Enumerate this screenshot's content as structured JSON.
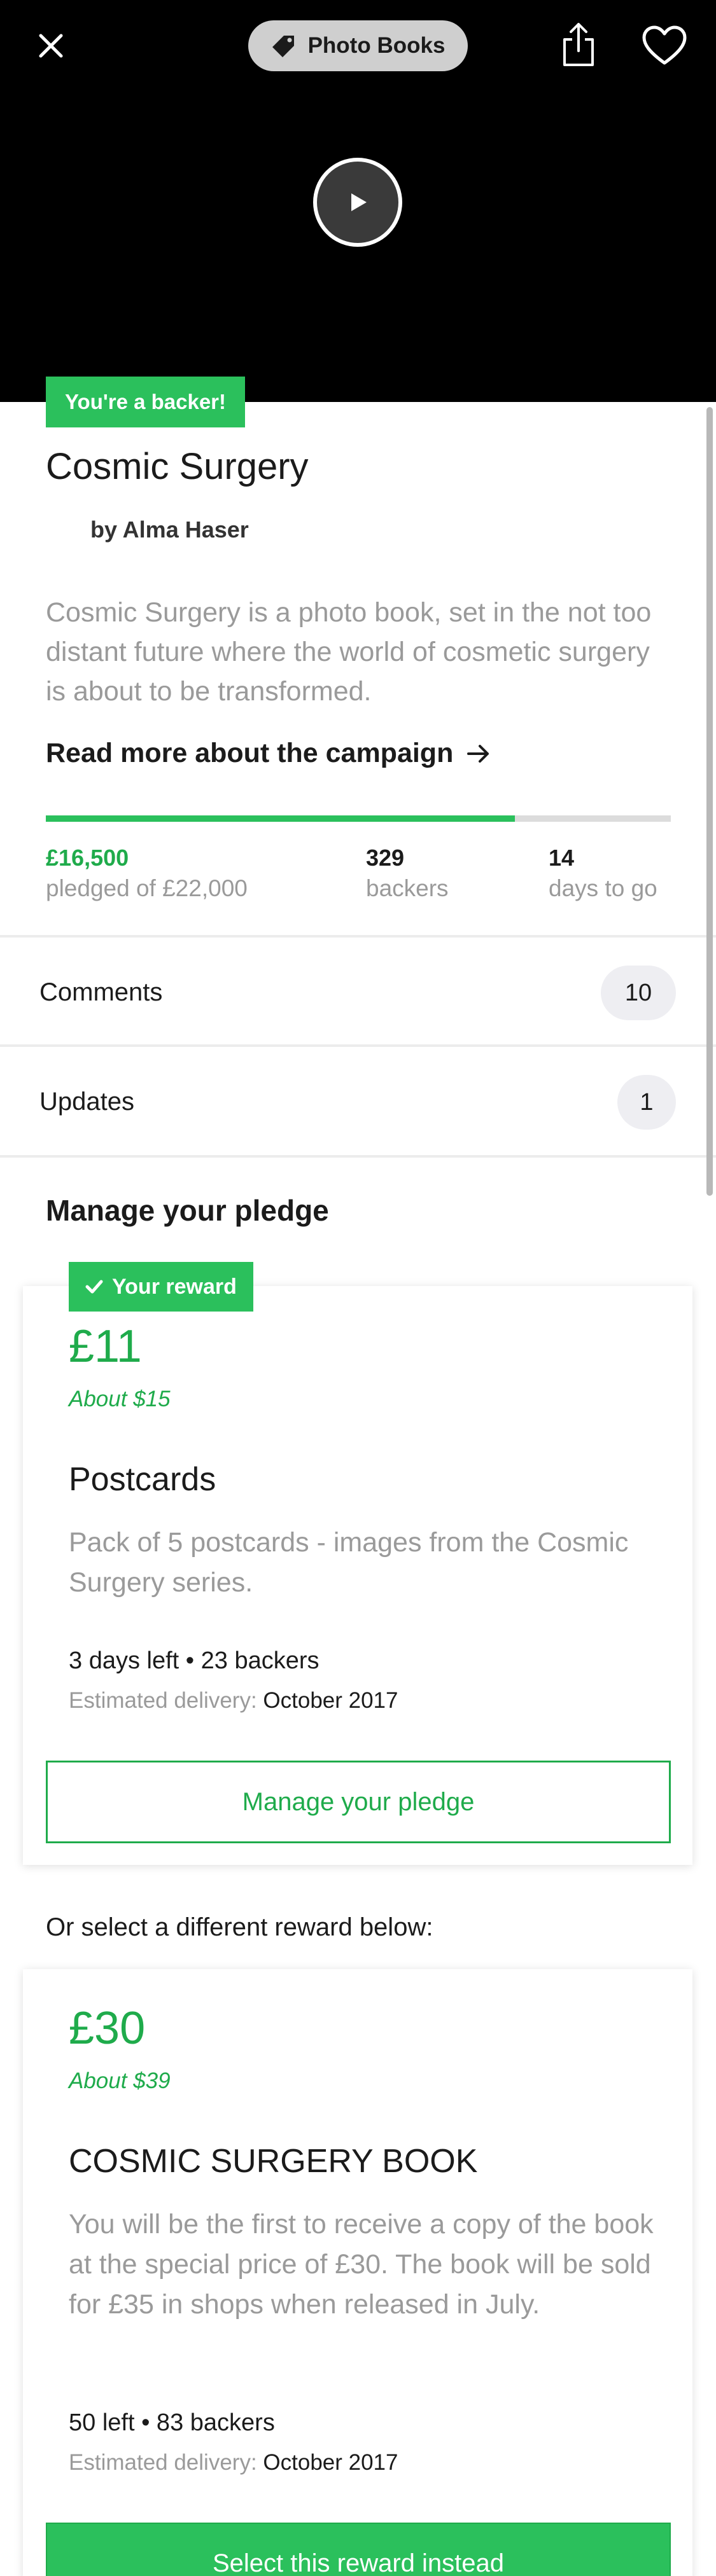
{
  "header": {
    "category": "Photo Books",
    "icons": {
      "close": "close-icon",
      "tag": "tag-icon",
      "share": "share-icon",
      "favorite": "heart-icon",
      "play": "play-icon"
    }
  },
  "project": {
    "backer_badge": "You're a backer!",
    "title": "Cosmic Surgery",
    "byline": "by Alma Haser",
    "blurb": "Cosmic Surgery is a photo book, set in the not too distant future where the world of cosmetic surgery is about to be transformed.",
    "read_more": "Read more about the campaign",
    "funded_fraction": 0.75,
    "stats": {
      "pledged_value": "£16,500",
      "pledged_label": "pledged of £22,000",
      "backers_value": "329",
      "backers_label": "backers",
      "days_value": "14",
      "days_label": "days to go"
    }
  },
  "rows": {
    "comments_label": "Comments",
    "comments_count": "10",
    "updates_label": "Updates",
    "updates_count": "1"
  },
  "pledge": {
    "section_title": "Manage your pledge",
    "your_reward_badge": "Your reward",
    "amount": "£11",
    "converted": "About $15",
    "title": "Postcards",
    "description": "Pack of 5 postcards - images from the Cosmic Surgery series.",
    "meta": "3 days left • 23 backers",
    "delivery_label": "Estimated delivery:",
    "delivery_value": "October 2017",
    "button": "Manage your pledge"
  },
  "other_rewards": {
    "prompt": "Or select a different reward below:",
    "items": [
      {
        "amount": "£30",
        "converted": "About $39",
        "title": "COSMIC SURGERY BOOK",
        "description": "You will be the first to receive a copy of the book at the special price of £30. The book will be sold for £35 in shops when released in July.",
        "meta": "50 left • 83 backers",
        "delivery_label": "Estimated delivery:",
        "delivery_value": "October 2017",
        "button": "Select this reward instead"
      }
    ]
  },
  "colors": {
    "green": "#2bc05c",
    "green_text": "#1fab4b",
    "muted": "#9a9a9a"
  }
}
